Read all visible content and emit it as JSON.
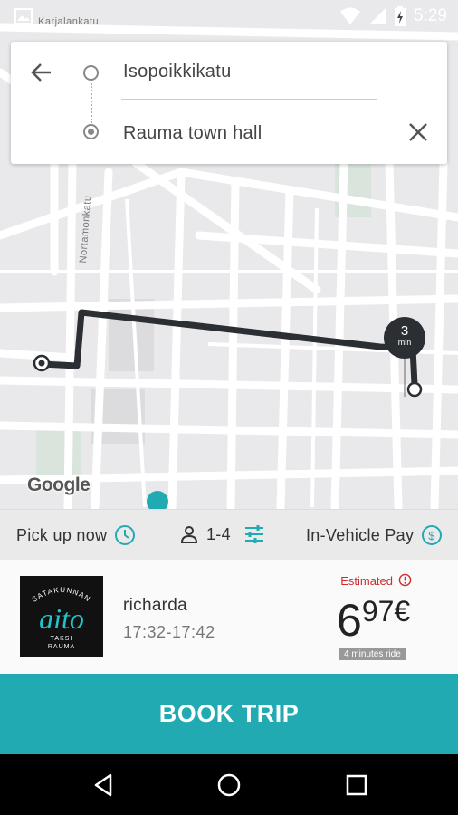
{
  "status_bar": {
    "time": "5:29",
    "icons": [
      "image-icon",
      "wifi-icon",
      "signal-icon",
      "battery-charging-icon"
    ]
  },
  "map": {
    "street_labels": [
      "Karjalankatu",
      "Nortamonkatu"
    ],
    "google_label": "Google",
    "eta_marker": {
      "value": "3",
      "unit": "min"
    }
  },
  "route": {
    "from": "Isopoikkikatu",
    "to": "Rauma town hall"
  },
  "options": {
    "pickup": "Pick up now",
    "passengers": "1-4",
    "payment": "In-Vehicle Pay"
  },
  "ride": {
    "logo_text_top": "SATAKUNNAN",
    "logo_text_main": "aito",
    "logo_text_bottom": "TAKSI\nRAUMA",
    "driver": "richarda",
    "time_range": "17:32-17:42",
    "estimated_label": "Estimated",
    "price_int": "6",
    "price_cents": "97€",
    "duration": "4 minutes ride"
  },
  "book_button": "BOOK TRIP",
  "colors": {
    "accent": "#22aab2",
    "estimate_red": "#d02a2a",
    "route": "#2b2f33"
  }
}
